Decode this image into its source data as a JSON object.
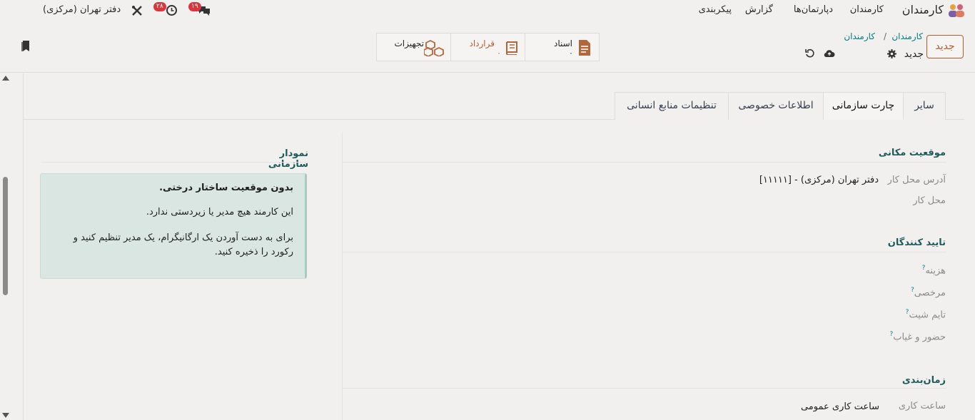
{
  "navbar": {
    "app_name": "کارمندان",
    "menu": [
      "کارمندان",
      "دپارتمان‌ها",
      "گزارش",
      "پیکربندی"
    ],
    "chat_badge": "۱۹",
    "activity_badge": "۲۸",
    "company": "دفتر تهران (مرکزی)"
  },
  "control": {
    "new_button": "جدید",
    "breadcrumb_parent": "کارمندان",
    "breadcrumb_current": "کارمندان",
    "record_name": "جدید",
    "stats": [
      {
        "label": "اسناد",
        "value": "۰"
      },
      {
        "label": "قرارداد",
        "value": "۰"
      },
      {
        "label": "تجهیزات",
        "value": ""
      }
    ]
  },
  "tabs": [
    "سایر",
    "چارت سازمانی",
    "اطلاعات خصوصی",
    "تنظیمات منابع انسانی"
  ],
  "active_tab": "چارت سازمانی",
  "location": {
    "title": "موقعیت مکانی",
    "work_address_label": "آدرس محل کار",
    "work_address_value": "دفتر تهران (مرکزی) - [۱۱۱۱۱]",
    "work_location_label": "محل کار"
  },
  "approvers": {
    "title": "تایید کنندگان",
    "fields": [
      "هزینه",
      "مرخصی",
      "تایم شیت",
      "حضور و غیاب"
    ],
    "help_mark": "?"
  },
  "schedule": {
    "title": "زمان‌بندی",
    "hours_label": "ساعت کاری",
    "hours_value": "ساعت کاری عمومی"
  },
  "org_chart": {
    "title": "نمودار سازمانی",
    "alert_title": "بدون موقعیت ساختار درختی.",
    "alert_line1": "این کارمند هیچ مدیر یا زیردستی ندارد.",
    "alert_line2": "برای به دست آوردن یک ارگانیگرام، یک مدیر تنظیم کنید و رکورد را ذخیره کنید."
  },
  "colors": {
    "accent": "#b85c2c",
    "link": "#017e84",
    "alert_bg": "#d9e6e2",
    "badge": "#d9363e"
  }
}
